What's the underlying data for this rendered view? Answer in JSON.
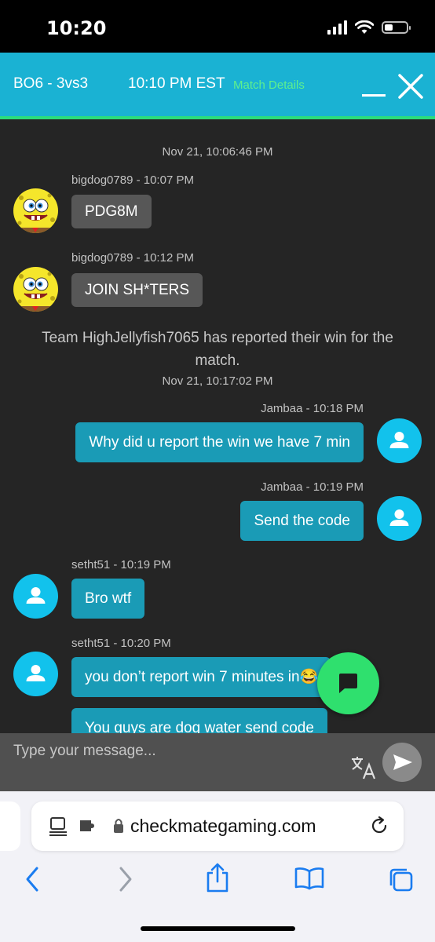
{
  "status_bar": {
    "time": "10:20"
  },
  "header": {
    "mode": "BO6 - 3vs3",
    "match_time": "10:10 PM EST",
    "match_details": "Match Details"
  },
  "chat": {
    "system_timestamp_1": "Nov 21, 10:06:46 PM",
    "system_message": "Team HighJellyfish7065 has reported their win for the match.",
    "system_timestamp_2": "Nov 21, 10:17:02 PM",
    "messages": [
      {
        "meta": "bigdog0789 - 10:07 PM",
        "text": "PDG8M"
      },
      {
        "meta": "bigdog0789 - 10:12 PM",
        "text": "JOIN SH*TERS"
      },
      {
        "meta": "Jambaa - 10:18 PM",
        "text": "Why did u report the win we have 7 min"
      },
      {
        "meta": "Jambaa - 10:19 PM",
        "text": "Send the code"
      },
      {
        "meta": "setht51 - 10:19 PM",
        "text": "Bro wtf"
      },
      {
        "meta": "setht51 - 10:20 PM",
        "text": "you don’t report win 7 minutes in😂"
      },
      {
        "meta": "",
        "text": "You guys are dog water send code"
      }
    ]
  },
  "composer": {
    "placeholder": "Type your message..."
  },
  "browser": {
    "url": "checkmategaming.com"
  },
  "colors": {
    "header": "#1ab2d3",
    "accent_green": "#2bdc7b",
    "bubble_blue": "#1a9bb6",
    "bubble_gray": "#575757",
    "chat_bg": "#252525"
  },
  "icons": [
    "signal-icon",
    "wifi-icon",
    "battery-icon",
    "minimize-icon",
    "close-icon",
    "user-icon",
    "chat-icon",
    "translate-icon",
    "send-icon",
    "reader-icon",
    "extension-icon",
    "lock-icon",
    "reload-icon",
    "back-icon",
    "forward-icon",
    "share-icon",
    "bookmarks-icon",
    "tabs-icon"
  ]
}
